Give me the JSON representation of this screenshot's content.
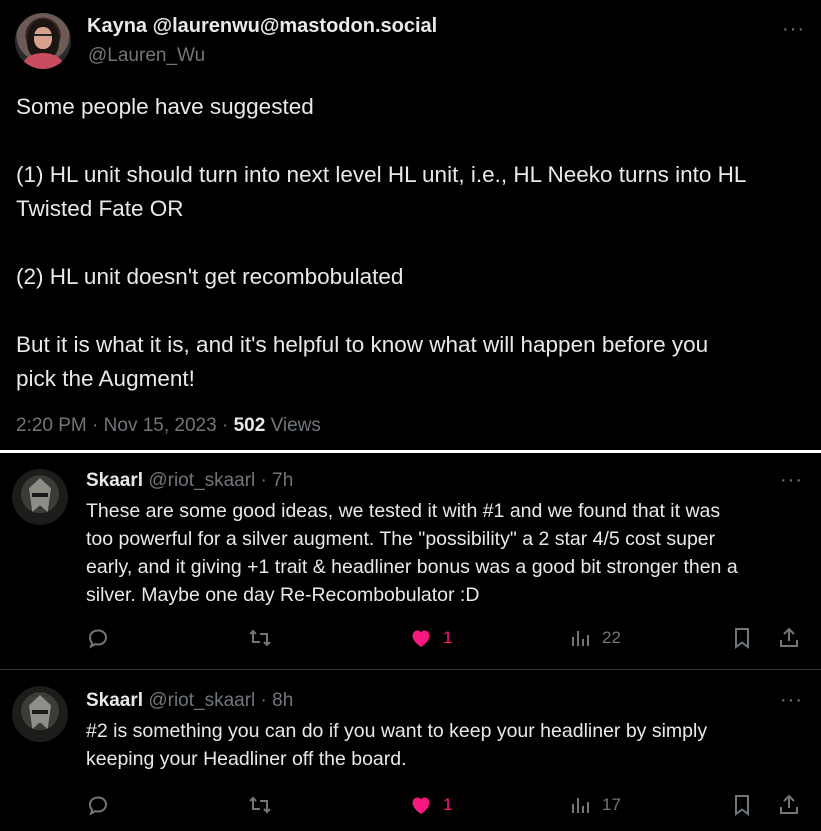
{
  "main_tweet": {
    "author_name": "Kayna @laurenwu@mastodon.social",
    "author_handle": "@Lauren_Wu",
    "more_label": "···",
    "text_lines": [
      "Some people have suggested",
      "",
      "(1) HL unit should turn into next level HL unit, i.e., HL Neeko turns into HL",
      "Twisted Fate OR",
      "",
      "(2) HL unit doesn't get recombobulated",
      "",
      "But it is what it is, and it's helpful to know what will happen before you",
      "pick the Augment!"
    ],
    "time": "2:20 PM",
    "separator": "·",
    "date": "Nov 15, 2023",
    "views_count": "502",
    "views_label": "Views"
  },
  "replies": [
    {
      "name": "Skaarl",
      "handle": "@riot_skaarl",
      "dot": "·",
      "time": "7h",
      "more_label": "···",
      "text_lines": [
        "These are some good ideas, we tested it with #1 and we found that it was",
        "too powerful for a silver augment. The \"possibility\" a 2 star 4/5 cost super",
        "early, and it giving +1 trait & headliner bonus was a good bit stronger then a",
        "silver. Maybe one day Re-Recombobulator :D"
      ],
      "likes": "1",
      "views": "22"
    },
    {
      "name": "Skaarl",
      "handle": "@riot_skaarl",
      "dot": "·",
      "time": "8h",
      "more_label": "···",
      "text_lines": [
        "#2 is something you can do if you want to keep your headliner by simply",
        "keeping your Headliner off the board."
      ],
      "likes": "1",
      "views": "17"
    }
  ],
  "colors": {
    "background": "#000000",
    "text": "#e7e9ea",
    "secondary": "#71767b",
    "like": "#f91880",
    "divider": "#2f3336"
  },
  "icons": [
    "reply-icon",
    "retweet-icon",
    "heart-icon",
    "views-icon",
    "bookmark-icon",
    "share-icon",
    "more-icon"
  ]
}
